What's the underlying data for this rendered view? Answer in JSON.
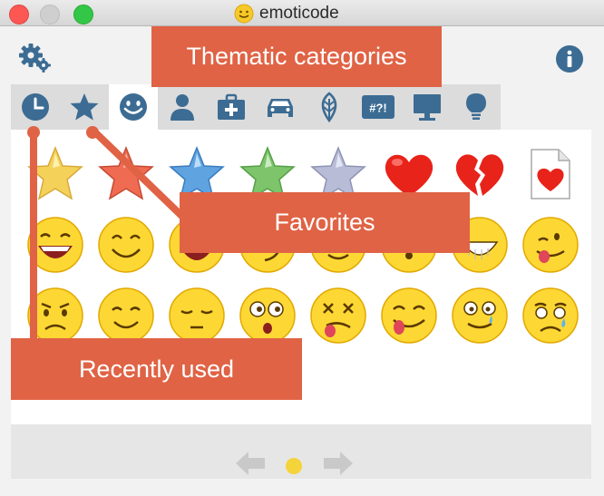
{
  "window": {
    "title": "emoticode"
  },
  "callouts": {
    "thematic": "Thematic categories",
    "favorites": "Favorites",
    "recent": "Recently used"
  },
  "icons": {
    "settings": "gear-icon",
    "info": "info-icon",
    "tabs": [
      "clock-icon",
      "star-icon",
      "smiley-icon",
      "person-icon",
      "medical-kit-icon",
      "car-icon",
      "leaf-icon",
      "symbols-icon",
      "monitor-icon",
      "lightbulb-icon"
    ],
    "pager": [
      "arrow-left-icon",
      "page-dot",
      "arrow-right-icon"
    ]
  },
  "symbols_tab_text": "#?!",
  "colors": {
    "accent": "#e06345",
    "tab_icon": "#3c6c93",
    "emoji_yellow": "#fdd835"
  }
}
